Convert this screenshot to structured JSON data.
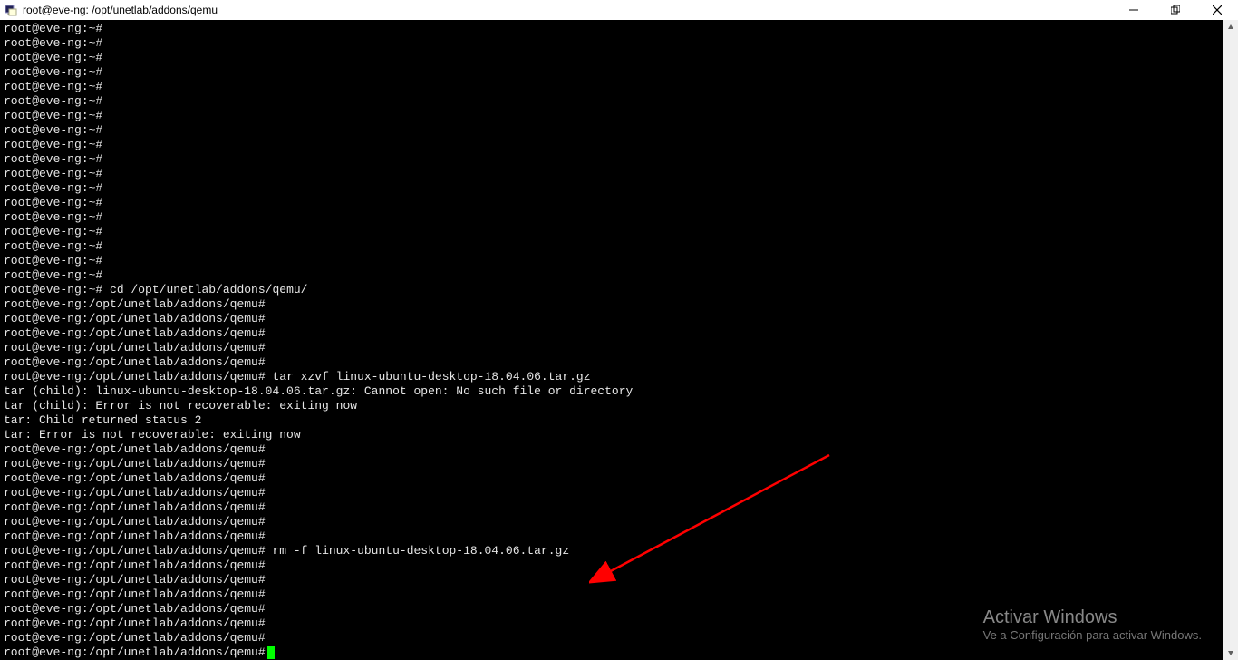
{
  "window": {
    "title": "root@eve-ng: /opt/unetlab/addons/qemu"
  },
  "prompts": {
    "home": "root@eve-ng:~#",
    "qemu": "root@eve-ng:/opt/unetlab/addons/qemu#"
  },
  "commands": {
    "cd": "cd /opt/unetlab/addons/qemu/",
    "tar": "tar xzvf linux-ubuntu-desktop-18.04.06.tar.gz",
    "rm": "rm -f linux-ubuntu-desktop-18.04.06.tar.gz"
  },
  "errors": {
    "e1": "tar (child): linux-ubuntu-desktop-18.04.06.tar.gz: Cannot open: No such file or directory",
    "e2": "tar (child): Error is not recoverable: exiting now",
    "e3": "tar: Child returned status 2",
    "e4": "tar: Error is not recoverable: exiting now"
  },
  "watermark": {
    "title": "Activar Windows",
    "subtitle": "Ve a Configuración para activar Windows."
  },
  "annotation": {
    "color": "#ff0000"
  }
}
